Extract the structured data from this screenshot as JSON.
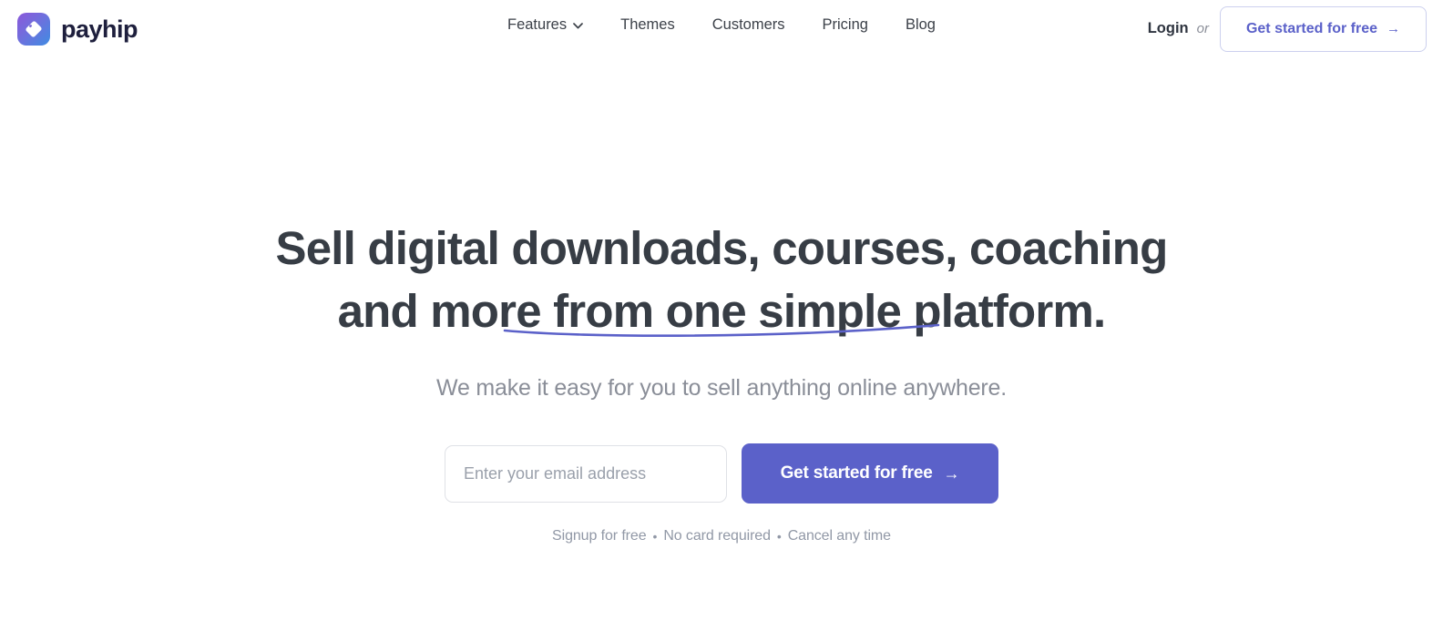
{
  "header": {
    "brand": {
      "wordmark": "payhip",
      "icon_name": "payhip-tag-heart-icon",
      "gradient_from": "#8b57da",
      "gradient_to": "#3f8ce2"
    },
    "nav_items": [
      {
        "label": "Features",
        "has_dropdown": true
      },
      {
        "label": "Themes",
        "has_dropdown": false
      },
      {
        "label": "Customers",
        "has_dropdown": false
      },
      {
        "label": "Pricing",
        "has_dropdown": false
      },
      {
        "label": "Blog",
        "has_dropdown": false
      }
    ],
    "login_label": "Login",
    "or_label": "or",
    "cta": {
      "label": "Get started for free",
      "arrow": "→",
      "text_color": "#5b61c9",
      "border_color": "#ccd0ee"
    }
  },
  "hero": {
    "headline_line1": "Sell digital downloads, courses, coaching",
    "headline_line2": "and more from one simple platform.",
    "headline_color": "#373d45",
    "underline_color": "#5b61c9",
    "subtitle": "We make it easy for you to sell anything online anywhere.",
    "subtitle_color": "#8a8e98",
    "email_placeholder": "Enter your email address",
    "email_value": "",
    "cta": {
      "label": "Get started for free",
      "arrow": "→",
      "background": "#5b61c9",
      "text_color": "#ffffff"
    },
    "fineprint": {
      "item1": "Signup for free",
      "sep1": "•",
      "item2": "No card required",
      "sep2": "•",
      "item3": "Cancel any time"
    }
  }
}
